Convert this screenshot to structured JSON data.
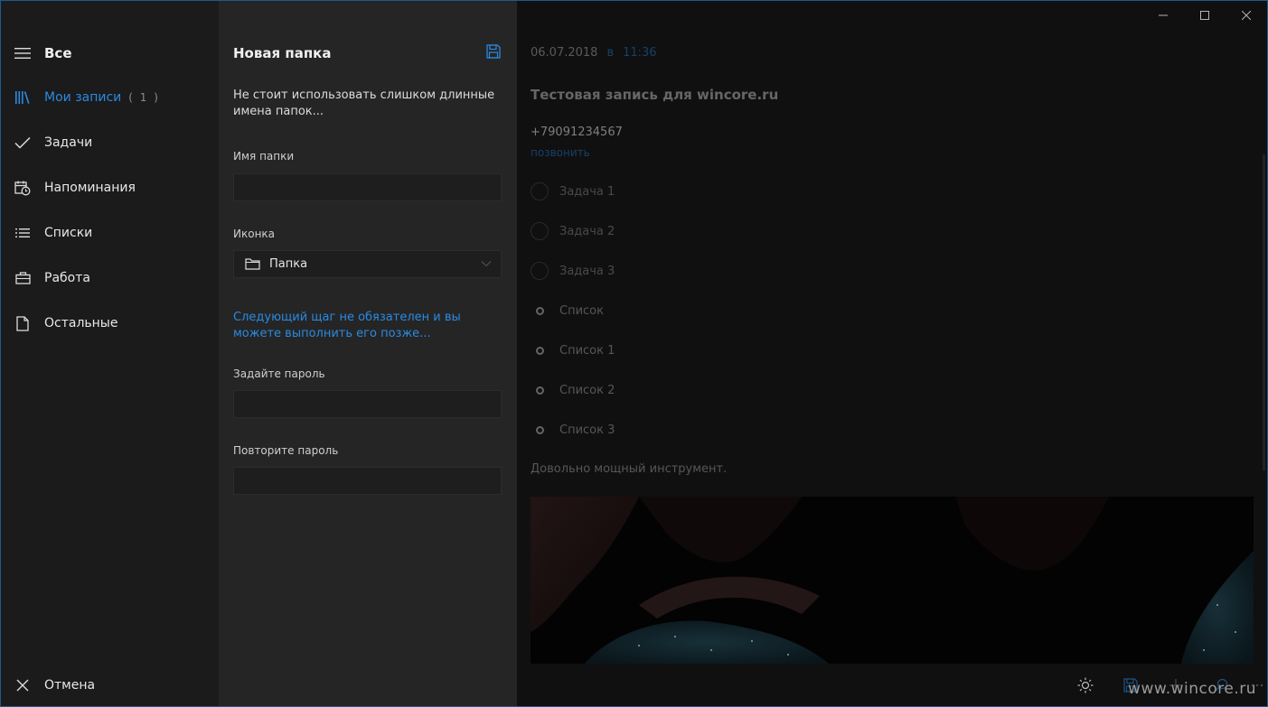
{
  "nav": {
    "title": "Все",
    "items": [
      {
        "label": "Мои записи",
        "count": "( 1 )"
      },
      {
        "label": "Задачи"
      },
      {
        "label": "Напоминания"
      },
      {
        "label": "Списки"
      },
      {
        "label": "Работа"
      },
      {
        "label": "Остальные"
      }
    ],
    "cancel": "Отмена"
  },
  "form": {
    "title": "Новая папка",
    "hint": "Не стоит использовать слишком длинные имена папок...",
    "folder_name_label": "Имя папки",
    "folder_name_value": "",
    "icon_label": "Иконка",
    "icon_value": "Папка",
    "optional_note": "Следующий щаг не обязателен и вы можете выполнить его позже...",
    "password_label": "Задайте пароль",
    "password_value": "",
    "repeat_password_label": "Повторите пароль",
    "repeat_password_value": ""
  },
  "note": {
    "date": "06.07.2018",
    "at": "в",
    "time": "11:36",
    "title": "Тестовая запись для wincore.ru",
    "phone": "+79091234567",
    "call": "позвонить",
    "tasks": [
      "Задача 1",
      "Задача 2",
      "Задача 3"
    ],
    "lists": [
      "Список",
      "Список 1",
      "Список 2",
      "Список 3"
    ],
    "description": "Довольно мощный инструмент."
  },
  "watermark": "www.wincore.ru",
  "colors": {
    "accent": "#2a8ae0",
    "nav_bg": "#1b1b1c",
    "form_bg": "#252526",
    "note_bg": "#141414"
  },
  "icons": {
    "menu": "hamburger-icon",
    "notes": "library-icon",
    "tasks": "checkmark-icon",
    "reminders": "calendar-clock-icon",
    "lists": "bulleted-list-icon",
    "work": "briefcase-icon",
    "other": "document-icon",
    "cancel": "close-icon",
    "save": "floppy-disk-icon",
    "folder": "folder-icon",
    "chevron": "chevron-down-icon",
    "brightness": "sun-icon",
    "add": "plus-icon",
    "search": "search-icon",
    "more": "more-icon"
  }
}
